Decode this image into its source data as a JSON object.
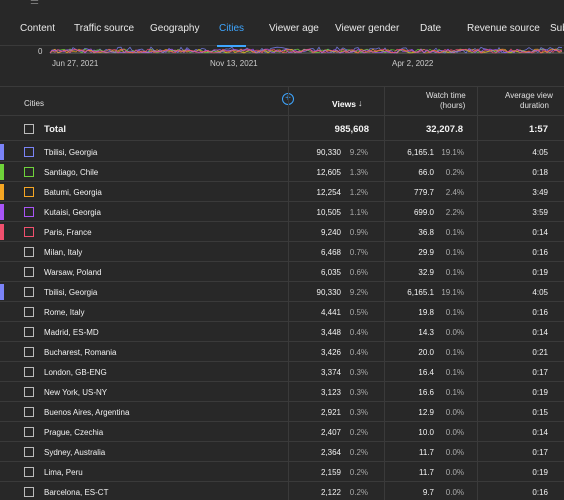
{
  "filter": {
    "label": "Filter"
  },
  "tabs": [
    {
      "label": "Content",
      "active": false
    },
    {
      "label": "Traffic source",
      "active": false
    },
    {
      "label": "Geography",
      "active": false
    },
    {
      "label": "Cities",
      "active": true
    },
    {
      "label": "Viewer age",
      "active": false
    },
    {
      "label": "Viewer gender",
      "active": false
    },
    {
      "label": "Date",
      "active": false
    },
    {
      "label": "Revenue source",
      "active": false
    },
    {
      "label": "Sub",
      "active": false
    }
  ],
  "chart": {
    "y_zero_label": "0",
    "dates": [
      "Jun 27, 2021",
      "Nov 13, 2021",
      "Apr 2, 2022"
    ]
  },
  "table": {
    "headers": {
      "cities": "Cities",
      "views": "Views",
      "watch_time": "Watch time",
      "watch_time_unit": "(hours)",
      "avg_view": "Average view",
      "avg_view2": "duration",
      "sort_icon": "arrow-down-icon",
      "add_icon": "plus-circle-icon"
    },
    "total": {
      "label": "Total",
      "views": "985,608",
      "watch": "32,207.8",
      "avg": "1:57"
    },
    "rows": [
      {
        "city": "Tbilisi, Georgia",
        "views": "90,330",
        "vp": "9.2%",
        "watch": "6,165.1",
        "wp": "19.1%",
        "avg": "4:05",
        "color": "#7b83f7",
        "checked": true
      },
      {
        "city": "Santiago, Chile",
        "views": "12,605",
        "vp": "1.3%",
        "watch": "66.0",
        "wp": "0.2%",
        "avg": "0:18",
        "color": "#6fd33a",
        "checked": true
      },
      {
        "city": "Batumi, Georgia",
        "views": "12,254",
        "vp": "1.2%",
        "watch": "779.7",
        "wp": "2.4%",
        "avg": "3:49",
        "color": "#f5a623",
        "checked": true
      },
      {
        "city": "Kutaisi, Georgia",
        "views": "10,505",
        "vp": "1.1%",
        "watch": "699.0",
        "wp": "2.2%",
        "avg": "3:59",
        "color": "#a855f7",
        "checked": true
      },
      {
        "city": "Paris, France",
        "views": "9,240",
        "vp": "0.9%",
        "watch": "36.8",
        "wp": "0.1%",
        "avg": "0:14",
        "color": "#f0506e",
        "checked": true
      },
      {
        "city": "Milan, Italy",
        "views": "6,468",
        "vp": "0.7%",
        "watch": "29.9",
        "wp": "0.1%",
        "avg": "0:16",
        "color": "",
        "checked": false
      },
      {
        "city": "Warsaw, Poland",
        "views": "6,035",
        "vp": "0.6%",
        "watch": "32.9",
        "wp": "0.1%",
        "avg": "0:19",
        "color": "",
        "checked": false
      },
      {
        "city": "Tbilisi, Georgia",
        "views": "90,330",
        "vp": "9.2%",
        "watch": "6,165.1",
        "wp": "19.1%",
        "avg": "4:05",
        "color": "#7b83f7",
        "checked": false
      },
      {
        "city": "Rome, Italy",
        "views": "4,441",
        "vp": "0.5%",
        "watch": "19.8",
        "wp": "0.1%",
        "avg": "0:16",
        "color": "",
        "checked": false
      },
      {
        "city": "Madrid, ES-MD",
        "views": "3,448",
        "vp": "0.4%",
        "watch": "14.3",
        "wp": "0.0%",
        "avg": "0:14",
        "color": "",
        "checked": false
      },
      {
        "city": "Bucharest, Romania",
        "views": "3,426",
        "vp": "0.4%",
        "watch": "20.0",
        "wp": "0.1%",
        "avg": "0:21",
        "color": "",
        "checked": false
      },
      {
        "city": "London, GB-ENG",
        "views": "3,374",
        "vp": "0.3%",
        "watch": "16.4",
        "wp": "0.1%",
        "avg": "0:17",
        "color": "",
        "checked": false
      },
      {
        "city": "New York, US-NY",
        "views": "3,123",
        "vp": "0.3%",
        "watch": "16.6",
        "wp": "0.1%",
        "avg": "0:19",
        "color": "",
        "checked": false
      },
      {
        "city": "Buenos Aires, Argentina",
        "views": "2,921",
        "vp": "0.3%",
        "watch": "12.9",
        "wp": "0.0%",
        "avg": "0:15",
        "color": "",
        "checked": false
      },
      {
        "city": "Prague, Czechia",
        "views": "2,407",
        "vp": "0.2%",
        "watch": "10.0",
        "wp": "0.0%",
        "avg": "0:14",
        "color": "",
        "checked": false
      },
      {
        "city": "Sydney, Australia",
        "views": "2,364",
        "vp": "0.2%",
        "watch": "11.7",
        "wp": "0.0%",
        "avg": "0:17",
        "color": "",
        "checked": false
      },
      {
        "city": "Lima, Peru",
        "views": "2,159",
        "vp": "0.2%",
        "watch": "11.7",
        "wp": "0.0%",
        "avg": "0:19",
        "color": "",
        "checked": false
      },
      {
        "city": "Barcelona, ES-CT",
        "views": "2,122",
        "vp": "0.2%",
        "watch": "9.7",
        "wp": "0.0%",
        "avg": "0:16",
        "color": "",
        "checked": false
      }
    ]
  },
  "colors": {
    "accent": "#3ea6ff",
    "background": "#282828",
    "divider": "#3a3a3a"
  }
}
